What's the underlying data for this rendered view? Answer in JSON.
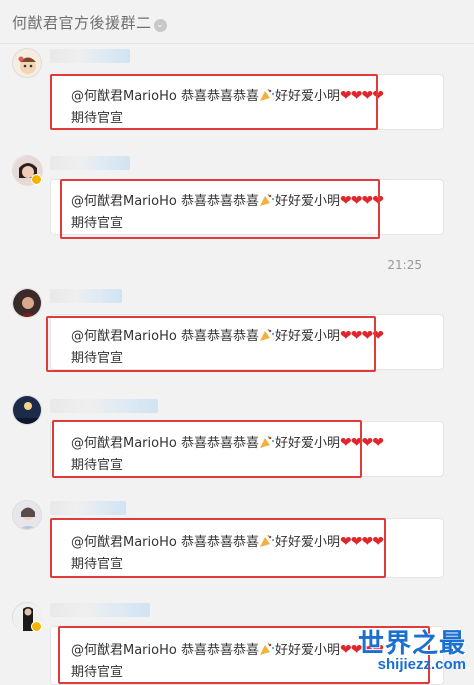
{
  "header": {
    "title": "何猷君官方後援群二"
  },
  "message_text": {
    "mention": "@何猷君MarioHo",
    "part1": "恭喜恭喜恭喜",
    "part2": "好好爱小明",
    "hearts": "❤❤❤❤",
    "line2": "期待官宣"
  },
  "timestamp": "21:25",
  "watermark": {
    "main": "世界之最",
    "sub": "shijiezz.com"
  },
  "colors": {
    "highlight_box": "#e03a3a",
    "heart": "#e0262b",
    "watermark": "#1b6fd1",
    "background": "#f2f2f2"
  },
  "messages": [
    {
      "avatar": "avatar-1"
    },
    {
      "avatar": "avatar-2"
    },
    {
      "avatar": "avatar-3"
    },
    {
      "avatar": "avatar-4"
    },
    {
      "avatar": "avatar-5"
    },
    {
      "avatar": "avatar-6"
    }
  ]
}
